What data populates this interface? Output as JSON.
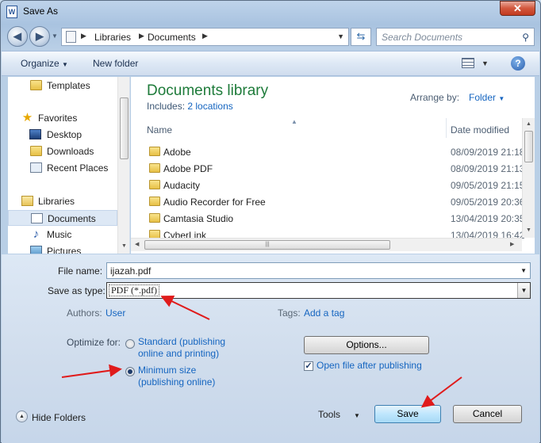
{
  "window": {
    "title": "Save As",
    "app_icon_letter": "W"
  },
  "address": {
    "segments": [
      "Libraries",
      "Documents"
    ],
    "search_placeholder": "Search Documents"
  },
  "toolbar": {
    "organize": "Organize",
    "new_folder": "New folder"
  },
  "navigation": {
    "templates": "Templates",
    "favorites": "Favorites",
    "desktop": "Desktop",
    "downloads": "Downloads",
    "recent_places": "Recent Places",
    "libraries": "Libraries",
    "documents": "Documents",
    "music": "Music",
    "pictures": "Pictures"
  },
  "library": {
    "title": "Documents library",
    "includes_label": "Includes:",
    "includes_link": "2 locations",
    "arrange_label": "Arrange by:",
    "arrange_value": "Folder"
  },
  "columns": {
    "name": "Name",
    "date_modified": "Date modified"
  },
  "files": [
    {
      "name": "Adobe",
      "date": "08/09/2019 21:18"
    },
    {
      "name": "Adobe PDF",
      "date": "08/09/2019 21:13"
    },
    {
      "name": "Audacity",
      "date": "09/05/2019 21:15"
    },
    {
      "name": "Audio Recorder for Free",
      "date": "09/05/2019 20:36"
    },
    {
      "name": "Camtasia Studio",
      "date": "13/04/2019 20:35"
    },
    {
      "name": "CyberLink",
      "date": "13/04/2019 16:42"
    }
  ],
  "form": {
    "file_name_label": "File name:",
    "file_name_value": "ijazah.pdf",
    "save_type_label": "Save as type:",
    "save_type_value": "PDF (*.pdf)",
    "authors_label": "Authors:",
    "authors_value": "User",
    "tags_label": "Tags:",
    "tags_value": "Add a tag",
    "optimize_label": "Optimize for:",
    "standard_line1": "Standard (publishing",
    "standard_line2": "online and printing)",
    "minimum_line1": "Minimum size",
    "minimum_line2": "(publishing online)",
    "optimize_selected": "Minimum size",
    "options_button": "Options...",
    "open_after_label": "Open file after publishing",
    "open_after_checked": true
  },
  "footer": {
    "hide_folders": "Hide Folders",
    "tools": "Tools",
    "save": "Save",
    "cancel": "Cancel"
  },
  "colors": {
    "annotation_arrow": "#e01b1b",
    "library_title": "#1e7b3a",
    "link": "#1565c0"
  }
}
